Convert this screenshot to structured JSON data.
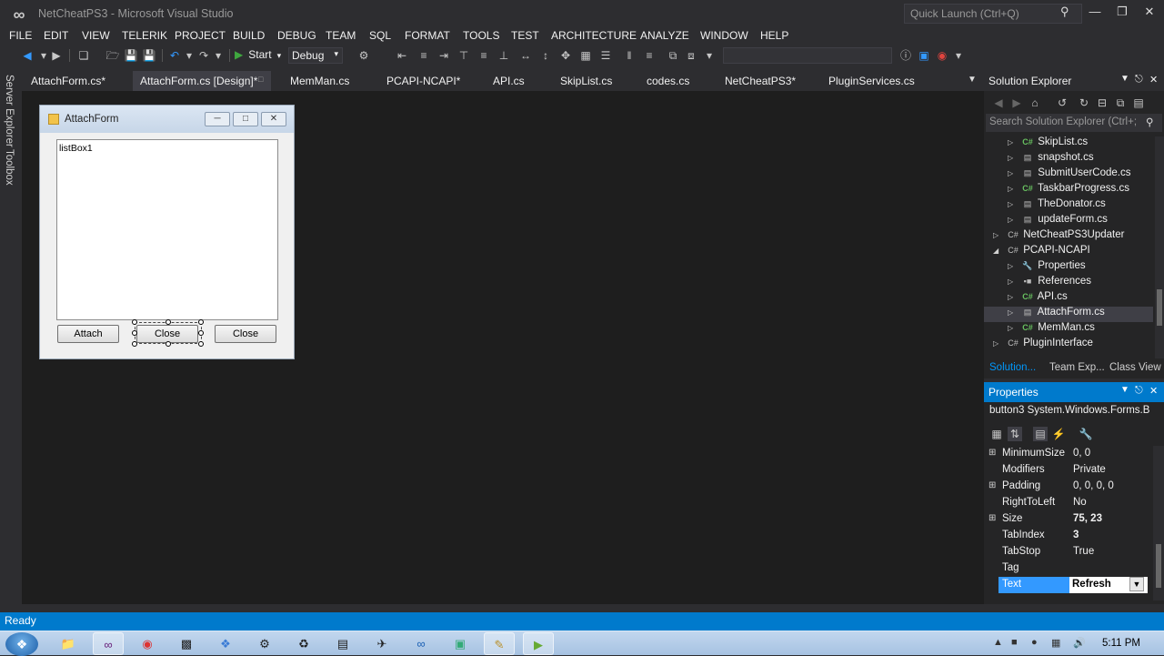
{
  "titlebar": {
    "logo": "visual-studio-icon",
    "title": "NetCheatPS3 - Microsoft Visual Studio",
    "quick_launch_placeholder": "Quick Launch (Ctrl+Q)",
    "minimize": "—",
    "maximize": "❐",
    "close": "✕"
  },
  "menu": [
    "FILE",
    "EDIT",
    "VIEW",
    "TELERIK",
    "PROJECT",
    "BUILD",
    "DEBUG",
    "TEAM",
    "SQL",
    "FORMAT",
    "TOOLS",
    "TEST",
    "ARCHITECTURE",
    "ANALYZE",
    "WINDOW",
    "HELP"
  ],
  "toolbar": {
    "start_label": "Start",
    "configuration": "Debug"
  },
  "side_tabs": {
    "server_explorer": "Server Explorer",
    "toolbox": "Toolbox"
  },
  "document_tabs": [
    {
      "label": "AttachForm.cs*",
      "active": false
    },
    {
      "label": "AttachForm.cs [Design]*",
      "active": true
    },
    {
      "label": "MemMan.cs",
      "active": false
    },
    {
      "label": "PCAPI-NCAPI*",
      "active": false
    },
    {
      "label": "API.cs",
      "active": false
    },
    {
      "label": "SkipList.cs",
      "active": false
    },
    {
      "label": "codes.cs",
      "active": false
    },
    {
      "label": "NetCheatPS3*",
      "active": false
    },
    {
      "label": "PluginServices.cs",
      "active": false
    }
  ],
  "designer_form": {
    "title": "AttachForm",
    "listbox_text": "listBox1",
    "buttons": [
      "Attach",
      "Close",
      "Close"
    ]
  },
  "solution_explorer": {
    "title": "Solution Explorer",
    "search_placeholder": "Search Solution Explorer (Ctrl+;",
    "items": [
      {
        "label": "SkipList.cs",
        "icon": "cs-file-icon",
        "expanded": false
      },
      {
        "label": "snapshot.cs",
        "icon": "form-file-icon",
        "expanded": false
      },
      {
        "label": "SubmitUserCode.cs",
        "icon": "form-file-icon",
        "expanded": false
      },
      {
        "label": "TaskbarProgress.cs",
        "icon": "cs-file-icon",
        "expanded": false
      },
      {
        "label": "TheDonator.cs",
        "icon": "form-file-icon",
        "expanded": false
      },
      {
        "label": "updateForm.cs",
        "icon": "form-file-icon",
        "expanded": false
      },
      {
        "label": "NetCheatPS3Updater",
        "icon": "cs-project-icon",
        "expanded": false
      },
      {
        "label": "PCAPI-NCAPI",
        "icon": "cs-project-icon",
        "expanded": true
      },
      {
        "label": "Properties",
        "icon": "wrench-icon",
        "expanded": false
      },
      {
        "label": "References",
        "icon": "references-icon",
        "expanded": false
      },
      {
        "label": "API.cs",
        "icon": "cs-file-icon",
        "expanded": false
      },
      {
        "label": "AttachForm.cs",
        "icon": "form-file-icon",
        "expanded": false,
        "selected": true
      },
      {
        "label": "MemMan.cs",
        "icon": "cs-file-icon",
        "expanded": false
      },
      {
        "label": "PluginInterface",
        "icon": "cs-project-icon",
        "expanded": false
      }
    ],
    "tabs": [
      {
        "label": "Solution...",
        "active": true
      },
      {
        "label": "Team Exp...",
        "active": false
      },
      {
        "label": "Class View",
        "active": false
      }
    ]
  },
  "properties": {
    "title": "Properties",
    "object": "button3  System.Windows.Forms.B",
    "rows": [
      {
        "name": "MinimumSize",
        "value": "0, 0",
        "expandable": true
      },
      {
        "name": "Modifiers",
        "value": "Private",
        "expandable": false
      },
      {
        "name": "Padding",
        "value": "0, 0, 0, 0",
        "expandable": true
      },
      {
        "name": "RightToLeft",
        "value": "No",
        "expandable": false
      },
      {
        "name": "Size",
        "value": "75, 23",
        "expandable": true,
        "bold": true
      },
      {
        "name": "TabIndex",
        "value": "3",
        "expandable": false,
        "bold": true
      },
      {
        "name": "TabStop",
        "value": "True",
        "expandable": false
      },
      {
        "name": "Tag",
        "value": "",
        "expandable": false
      },
      {
        "name": "Text",
        "value": "Refresh",
        "expandable": false,
        "editing": true
      }
    ]
  },
  "status": {
    "text": "Ready"
  },
  "taskbar": {
    "clock": "5:11 PM",
    "apps": [
      "explorer-icon",
      "visual-studio-icon",
      "chrome-icon",
      "cmd-icon",
      "app-icon",
      "app-icon",
      "app-icon",
      "app-icon",
      "app-icon",
      "app-icon",
      "app-icon",
      "notepad-icon",
      "app-icon"
    ]
  }
}
